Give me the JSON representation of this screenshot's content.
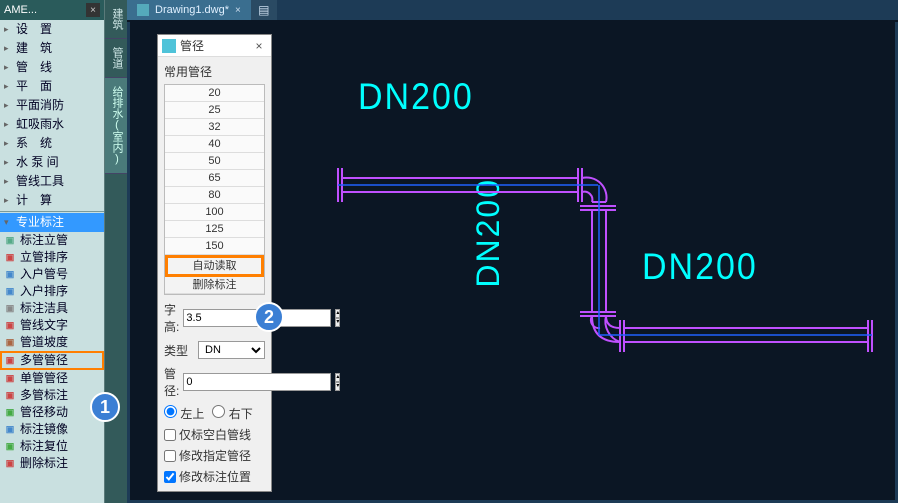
{
  "tree_panel": {
    "title": "AME...",
    "categories": [
      "设　置",
      "建　筑",
      "管　线",
      "平　面",
      "平面消防",
      "虹吸雨水",
      "系　统",
      "水 泵 间",
      "管线工具",
      "计　算"
    ],
    "special_label": "专业标注",
    "tools": [
      "标注立管",
      "立管排序",
      "入户管号",
      "入户排序",
      "标注洁具",
      "管线文字",
      "管道坡度",
      "多管管径",
      "单管管径",
      "多管标注",
      "管径移动",
      "标注镜像",
      "标注复位",
      "删除标注"
    ],
    "highlighted_tool": "多管管径"
  },
  "side_tabs": [
    "建筑",
    "管道",
    "给排水(室内)"
  ],
  "file_tab": {
    "name": "Drawing1.dwg*"
  },
  "dialog": {
    "title": "管径",
    "group": "常用管径",
    "sizes": [
      "20",
      "25",
      "32",
      "40",
      "50",
      "65",
      "80",
      "100",
      "125",
      "150"
    ],
    "btn_auto": "自动读取",
    "btn_del": "删除标注",
    "lbl_height": "字高:",
    "val_height": "3.5",
    "lbl_type": "类型",
    "val_type": "DN",
    "lbl_diam": "管径:",
    "val_diam": "0",
    "radio_lt": "左上",
    "radio_rb": "右下",
    "chk_blank": "仅标空白管线",
    "chk_modify": "修改指定管径",
    "chk_pos": "修改标注位置"
  },
  "drawing": {
    "label1": "DN200",
    "label2": "DN200",
    "label3": "DN200"
  },
  "badges": {
    "b1": "1",
    "b2": "2"
  }
}
